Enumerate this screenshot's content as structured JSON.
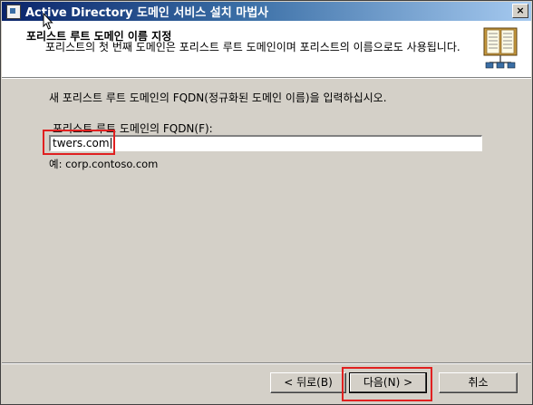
{
  "window": {
    "title": "Active Directory 도메인 서비스 설치 마법사",
    "close_glyph": "×"
  },
  "header": {
    "title": "포리스트 루트 도메인 이름 지정",
    "subtitle": "포리스트의 첫 번째 도메인은 포리스트 루트 도메인이며 포리스트의 이름으로도 사용됩니다."
  },
  "body": {
    "prompt": "새 포리스트 루트 도메인의 FQDN(정규화된 도메인 이름)을 입력하십시오.",
    "fqdn_label": "포리스트 루트 도메인의 FQDN(F):",
    "fqdn_value": "twers.com",
    "example": "예: corp.contoso.com"
  },
  "buttons": {
    "back": "< 뒤로(B)",
    "next": "다음(N) >",
    "cancel": "취소"
  },
  "colors": {
    "highlight": "#e02020",
    "title_gradient_start": "#0a246a",
    "title_gradient_end": "#a6caf0",
    "face": "#d4d0c8"
  }
}
